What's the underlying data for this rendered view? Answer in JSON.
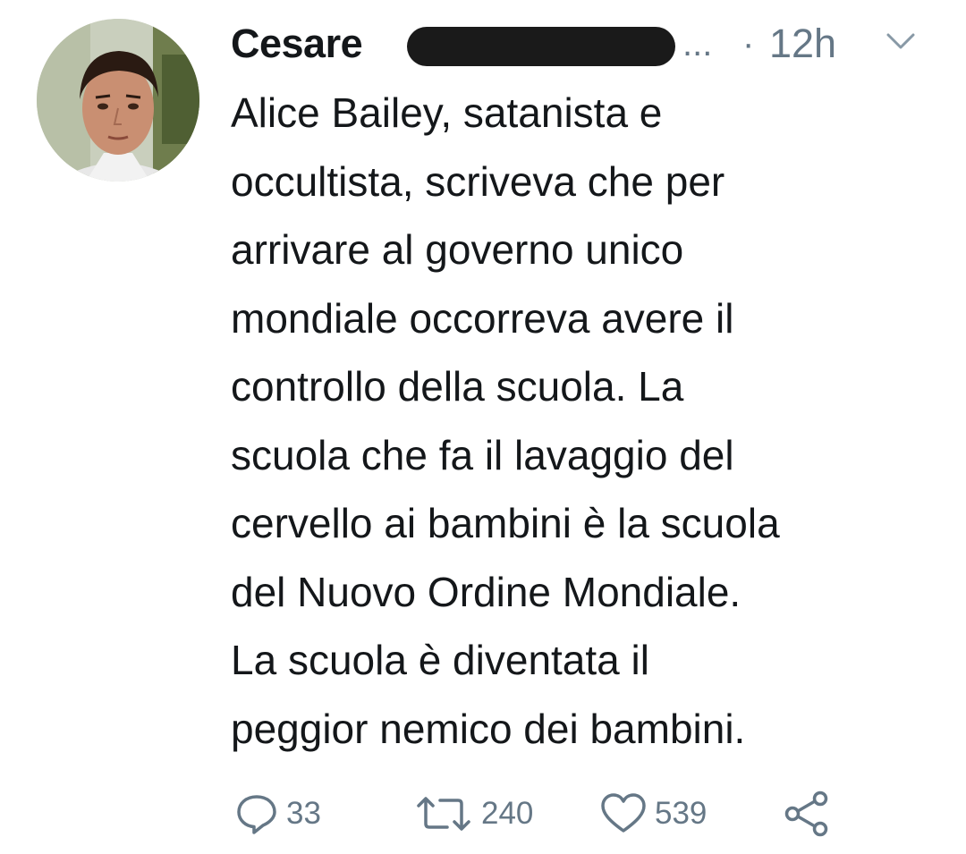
{
  "tweet": {
    "display_name": "Cesare",
    "handle_truncated": "...",
    "separator": "·",
    "timestamp": "12h",
    "text_lines": [
      "Alice Bailey, satanista e",
      "occultista, scriveva che per",
      "arrivare al governo unico",
      "mondiale occorreva avere il",
      "controllo della scuola. La",
      "scuola che fa il lavaggio del",
      "cervello ai bambini è la scuola",
      "del Nuovo Ordine Mondiale.",
      "La scuola è diventata il",
      "peggior nemico dei bambini."
    ],
    "actions": {
      "reply_count": "33",
      "retweet_count": "240",
      "like_count": "539"
    }
  },
  "icons": {
    "reply": "reply-icon",
    "retweet": "retweet-icon",
    "like": "heart-icon",
    "share": "share-icon",
    "menu": "chevron-down-icon"
  },
  "colors": {
    "text_primary": "#14171a",
    "text_secondary": "#657786",
    "icon_gray": "#657786",
    "redaction": "#1a1a1a",
    "background": "#ffffff"
  }
}
